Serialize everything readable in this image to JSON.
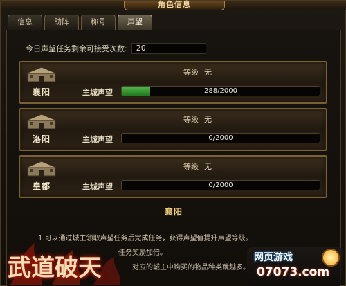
{
  "window": {
    "title": "角色信息"
  },
  "tabs": [
    {
      "label": "信息"
    },
    {
      "label": "助阵"
    },
    {
      "label": "称号"
    },
    {
      "label": "声望",
      "active": true
    }
  ],
  "quest": {
    "label": "今日声望任务剩余可接受次数:",
    "value": "20"
  },
  "cities": [
    {
      "name": "襄阳",
      "level_label": "等级",
      "level_value": "无",
      "rep_label": "主城声望",
      "progress_text": "288/2000",
      "progress_fraction": 0.144
    },
    {
      "name": "洛阳",
      "level_label": "等级",
      "level_value": "无",
      "rep_label": "主城声望",
      "progress_text": "0/2000",
      "progress_fraction": 0
    },
    {
      "name": "皇都",
      "level_label": "等级",
      "level_value": "无",
      "rep_label": "主城声望",
      "progress_text": "0/2000",
      "progress_fraction": 0
    }
  ],
  "section": {
    "title": "襄阳",
    "lines": [
      "1.可以通过城主领取声望任务后完成任务，获得声望值提升声望等级。",
      "任务奖励加倍。",
      "对应的城主中购买的物品种类就越多。"
    ]
  },
  "logo": {
    "text": "武道破天"
  },
  "watermark": {
    "line1": "网页游戏",
    "line2": "07073.com"
  },
  "colors": {
    "progress": "#4fb84a",
    "accent_gold": "#f0cf7a",
    "frame_border": "#7a6135"
  }
}
